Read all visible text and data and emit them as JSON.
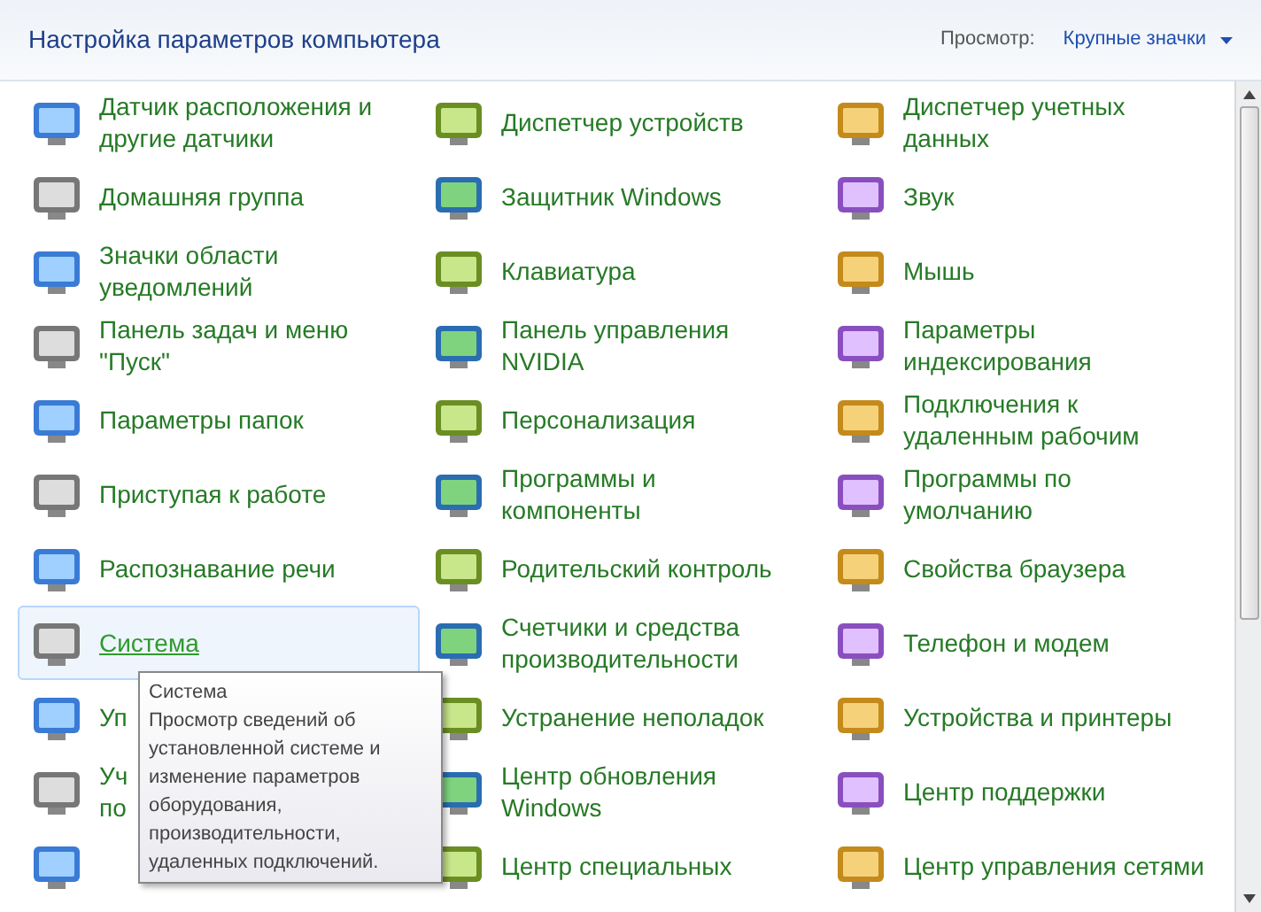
{
  "header": {
    "title": "Настройка параметров компьютера",
    "view_label": "Просмотр:",
    "view_value": "Крупные значки"
  },
  "items": [
    {
      "lines": [
        "Датчик расположения и",
        "другие датчики"
      ],
      "highlighted": false
    },
    {
      "lines": [
        "Диспетчер устройств"
      ],
      "highlighted": false
    },
    {
      "lines": [
        "Диспетчер учетных",
        "данных"
      ],
      "highlighted": false
    },
    {
      "lines": [
        "Домашняя группа"
      ],
      "highlighted": false
    },
    {
      "lines": [
        "Защитник Windows"
      ],
      "highlighted": false
    },
    {
      "lines": [
        "Звук"
      ],
      "highlighted": false
    },
    {
      "lines": [
        "Значки области",
        "уведомлений"
      ],
      "highlighted": false
    },
    {
      "lines": [
        "Клавиатура"
      ],
      "highlighted": false
    },
    {
      "lines": [
        "Мышь"
      ],
      "highlighted": false
    },
    {
      "lines": [
        "Панель задач и меню",
        "\"Пуск\""
      ],
      "highlighted": false
    },
    {
      "lines": [
        "Панель управления",
        "NVIDIA"
      ],
      "highlighted": false
    },
    {
      "lines": [
        "Параметры",
        "индексирования"
      ],
      "highlighted": false
    },
    {
      "lines": [
        "Параметры папок"
      ],
      "highlighted": false
    },
    {
      "lines": [
        "Персонализация"
      ],
      "highlighted": false
    },
    {
      "lines": [
        "Подключения к",
        "удаленным рабочим"
      ],
      "highlighted": false
    },
    {
      "lines": [
        "Приступая к работе"
      ],
      "highlighted": false
    },
    {
      "lines": [
        "Программы и",
        "компоненты"
      ],
      "highlighted": false
    },
    {
      "lines": [
        "Программы по",
        "умолчанию"
      ],
      "highlighted": false
    },
    {
      "lines": [
        "Распознавание речи"
      ],
      "highlighted": false
    },
    {
      "lines": [
        "Родительский контроль"
      ],
      "highlighted": false
    },
    {
      "lines": [
        "Свойства браузера"
      ],
      "highlighted": false
    },
    {
      "lines": [
        "Система"
      ],
      "highlighted": true,
      "tooltip": {
        "title": "Система",
        "text": "Просмотр сведений об установленной системе и изменение параметров оборудования, производительности, удаленных подключений."
      }
    },
    {
      "lines": [
        "Счетчики и средства",
        "производительности"
      ],
      "highlighted": false
    },
    {
      "lines": [
        "Телефон и модем"
      ],
      "highlighted": false
    },
    {
      "lines": [
        "Уп"
      ],
      "highlighted": false
    },
    {
      "lines": [
        "Устранение неполадок"
      ],
      "highlighted": false
    },
    {
      "lines": [
        "Устройства и принтеры"
      ],
      "highlighted": false
    },
    {
      "lines": [
        "Уч",
        "по"
      ],
      "highlighted": false
    },
    {
      "lines": [
        "Центр обновления",
        "Windows"
      ],
      "highlighted": false
    },
    {
      "lines": [
        "Центр поддержки"
      ],
      "highlighted": false
    },
    {
      "highlighted": false
    },
    {
      "lines": [
        "Центр специальных"
      ],
      "highlighted": false
    },
    {
      "lines": [
        "Центр управления сетями"
      ],
      "highlighted": false
    }
  ]
}
